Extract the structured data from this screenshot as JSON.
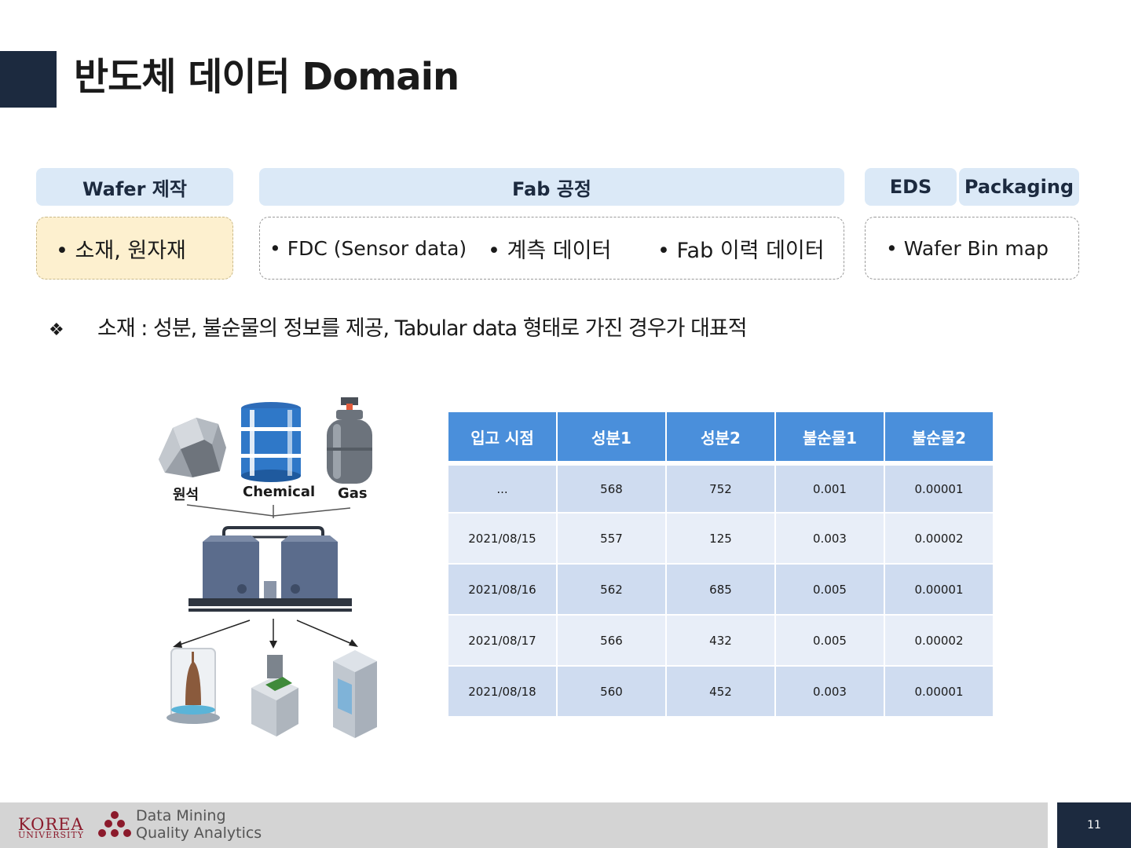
{
  "slide": {
    "title": "반도체 데이터 Domain",
    "page_number": "11"
  },
  "stages": {
    "wafer": {
      "header": "Wafer 제작",
      "items": [
        "• 소재, 원자재"
      ]
    },
    "fab": {
      "header": "Fab 공정",
      "items": [
        "• FDC (Sensor data)",
        "• 계측 데이터",
        "• Fab 이력 데이터"
      ]
    },
    "eds": {
      "header": "EDS"
    },
    "packaging": {
      "header": "Packaging",
      "items": [
        "• Wafer Bin map"
      ]
    }
  },
  "note": {
    "bullet": "❖",
    "text": "소재 : 성분, 불순물의 정보를 제공, Tabular data 형태로 가진 경우가 대표적"
  },
  "illustration": {
    "labels": {
      "ore": "원석",
      "chemical": "Chemical",
      "gas": "Gas"
    }
  },
  "table": {
    "headers": [
      "입고 시점",
      "성분1",
      "성분2",
      "불순물1",
      "불순물2"
    ],
    "rows": [
      [
        "...",
        "568",
        "752",
        "0.001",
        "0.00001"
      ],
      [
        "2021/08/15",
        "557",
        "125",
        "0.003",
        "0.00002"
      ],
      [
        "2021/08/16",
        "562",
        "685",
        "0.005",
        "0.00001"
      ],
      [
        "2021/08/17",
        "566",
        "432",
        "0.005",
        "0.00002"
      ],
      [
        "2021/08/18",
        "560",
        "452",
        "0.003",
        "0.00001"
      ]
    ]
  },
  "footer": {
    "university": "KOREA",
    "university_sub": "UNIVERSITY",
    "lab_line1": "Data Mining",
    "lab_line2": "Quality Analytics"
  }
}
